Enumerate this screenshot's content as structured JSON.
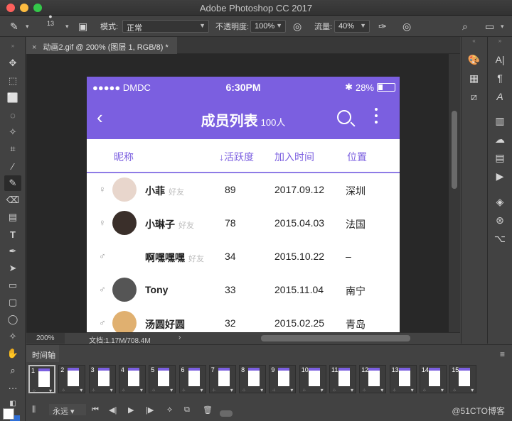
{
  "window": {
    "title": "Adobe Photoshop CC 2017"
  },
  "options": {
    "brush_size": "13",
    "mode_label": "模式:",
    "mode_value": "正常",
    "opacity_label": "不透明度:",
    "opacity_value": "100%",
    "flow_label": "流量:",
    "flow_value": "40%"
  },
  "document": {
    "tab_label": "动画2.gif @ 200% (图层 1, RGB/8) *"
  },
  "status": {
    "zoom": "200%",
    "doc_info": "文档:1.17M/708.4M",
    "chevron": "›"
  },
  "phone": {
    "carrier": "●●●●● DMDC",
    "time": "6:30PM",
    "battery": "28%",
    "battery_level": 0.28,
    "title": "成员列表",
    "count": "100人",
    "headers": {
      "name": "昵称",
      "activity": "↓活跃度",
      "joined": "加入时间",
      "location": "位置"
    },
    "rows": [
      {
        "gender": "♀",
        "name": "小菲",
        "tag": "好友",
        "activity": "89",
        "joined": "2017.09.12",
        "location": "深圳"
      },
      {
        "gender": "♀",
        "name": "小琳子",
        "tag": "好友",
        "activity": "78",
        "joined": "2015.04.03",
        "location": "法国"
      },
      {
        "gender": "♂",
        "name": "啊嘿嘿嘿",
        "tag": "好友",
        "activity": "34",
        "joined": "2015.10.22",
        "location": "–"
      },
      {
        "gender": "♂",
        "name": "Tony",
        "tag": "",
        "activity": "33",
        "joined": "2015.11.04",
        "location": "南宁"
      },
      {
        "gender": "♂",
        "name": "汤圆好圆",
        "tag": "",
        "activity": "32",
        "joined": "2015.02.25",
        "location": "青岛"
      }
    ]
  },
  "timeline": {
    "tab_label": "时间轴",
    "frames": [
      "1",
      "2",
      "3",
      "4",
      "5",
      "6",
      "7",
      "8",
      "9",
      "10",
      "11",
      "12",
      "13",
      "14",
      "15"
    ],
    "loop_value": "永远"
  },
  "watermark": "@51CTO博客",
  "colors": {
    "accent": "#7b5fe0",
    "panel": "#424242",
    "canvas": "#282828"
  }
}
